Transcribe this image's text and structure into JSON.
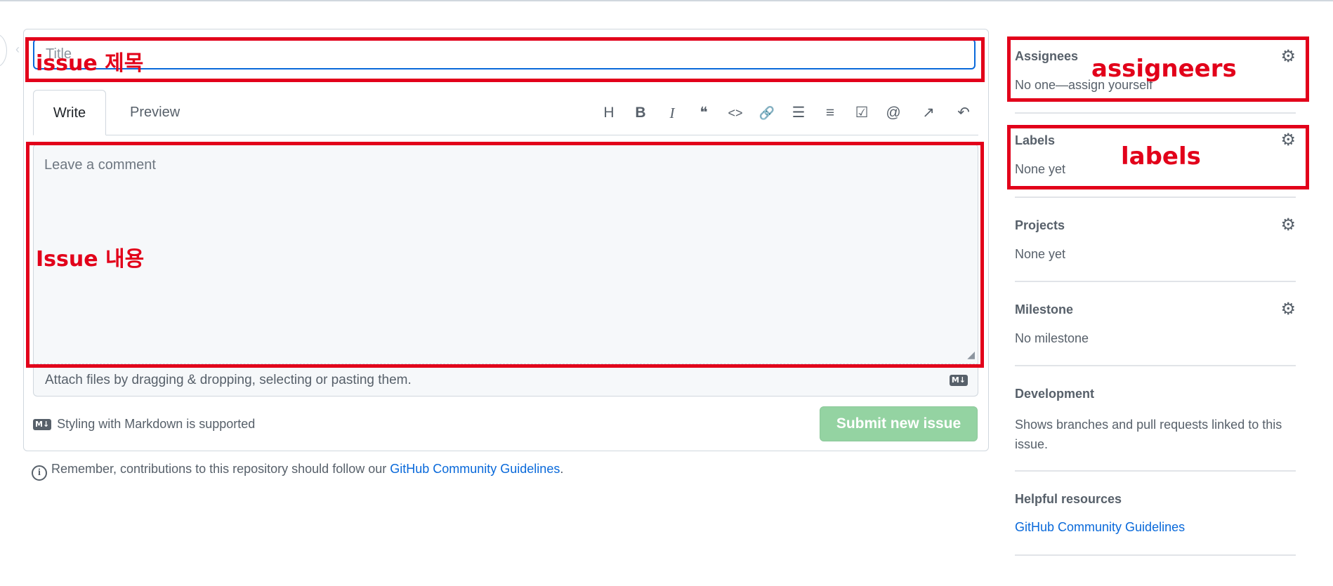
{
  "title_field": {
    "placeholder": "Title"
  },
  "tabs": {
    "write": "Write",
    "preview": "Preview"
  },
  "toolbar": [
    {
      "name": "heading-icon",
      "glyph": "H"
    },
    {
      "name": "bold-icon",
      "glyph": "B"
    },
    {
      "name": "italic-icon",
      "glyph": "I"
    },
    {
      "name": "quote-icon",
      "glyph": "❝"
    },
    {
      "name": "code-icon",
      "glyph": "<>"
    },
    {
      "name": "link-icon",
      "glyph": "🔗"
    },
    {
      "name": "bulleted-list-icon",
      "glyph": "☰"
    },
    {
      "name": "numbered-list-icon",
      "glyph": "≡"
    },
    {
      "name": "task-list-icon",
      "glyph": "☑"
    },
    {
      "name": "mention-icon",
      "glyph": "@"
    },
    {
      "name": "reference-icon",
      "glyph": "↗"
    },
    {
      "name": "undo-icon",
      "glyph": "↶"
    }
  ],
  "comment": {
    "placeholder": "Leave a comment"
  },
  "attach": {
    "text": "Attach files by dragging & dropping, selecting or pasting them.",
    "md_badge": "M↓"
  },
  "styling_note": {
    "badge": "M↓",
    "text": "Styling with Markdown is supported"
  },
  "submit_label": "Submit new issue",
  "footer": {
    "prefix": "Remember, contributions to this repository should follow our ",
    "link": "GitHub Community Guidelines",
    "suffix": "."
  },
  "sidebar": {
    "assignees": {
      "title": "Assignees",
      "value": "No one—assign yourself"
    },
    "labels": {
      "title": "Labels",
      "value": "None yet"
    },
    "projects": {
      "title": "Projects",
      "value": "None yet"
    },
    "milestone": {
      "title": "Milestone",
      "value": "No milestone"
    },
    "development": {
      "title": "Development",
      "value": "Shows branches and pull requests linked to this issue."
    },
    "helpful": {
      "title": "Helpful resources",
      "link": "GitHub Community Guidelines"
    }
  },
  "annotations": {
    "title": "issue 제목",
    "body": "Issue 내용",
    "assignees": "assigneers",
    "labels": "labels"
  },
  "colors": {
    "annotation": "#e2001a",
    "accent": "#0969da",
    "submit_disabled": "#94d3a2"
  }
}
